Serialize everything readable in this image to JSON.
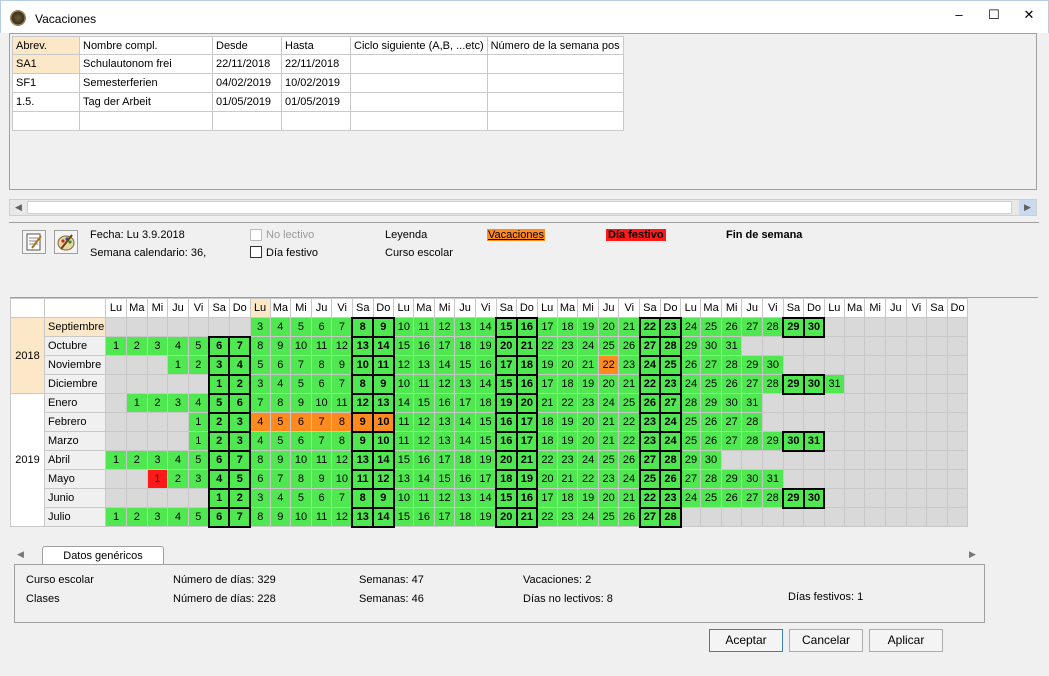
{
  "window": {
    "title": "Vacaciones",
    "minimize": "–",
    "maximize": "☐",
    "close": "✕",
    "icon": "app-clock-icon"
  },
  "holidays_table": {
    "columns": [
      "Abrev.",
      "Nombre compl.",
      "Desde",
      "Hasta",
      "Ciclo siguiente (A,B, ...etc)",
      "Número de la semana pos"
    ],
    "rows": [
      [
        "SA1",
        "Schulautonom frei",
        "22/11/2018",
        "22/11/2018",
        "",
        ""
      ],
      [
        "SF1",
        "Semesterferien",
        "04/02/2019",
        "10/02/2019",
        "",
        ""
      ],
      [
        "1.5.",
        "Tag der Arbeit",
        "01/05/2019",
        "01/05/2019",
        "",
        ""
      ],
      [
        "",
        "",
        "",
        "",
        "",
        ""
      ]
    ]
  },
  "info": {
    "fecha": "Fecha: Lu 3.9.2018",
    "semana": "Semana calendario: 36,",
    "no_lectivo": "No lectivo",
    "dia_festivo_chk": "Día festivo",
    "leyenda": "Leyenda",
    "curso_escolar": "Curso escolar",
    "legend_vacaciones": "Vacaciones",
    "legend_festivo": "Día festivo",
    "legend_fin_semana": "Fin de semana"
  },
  "colors": {
    "school_day": "#50e850",
    "vacation": "#ff8a1e",
    "holiday": "#ff1a1a",
    "outside": "#d9d9d9",
    "selected_header": "#fce8c8"
  },
  "calendar": {
    "weekday_headers": [
      "Lu",
      "Ma",
      "Mi",
      "Ju",
      "Vi",
      "Sa",
      "Do",
      "Lu",
      "Ma",
      "Mi",
      "Ju",
      "Vi",
      "Sa",
      "Do",
      "Lu",
      "Ma",
      "Mi",
      "Ju",
      "Vi",
      "Sa",
      "Do",
      "Lu",
      "Ma",
      "Mi",
      "Ju",
      "Vi",
      "Sa",
      "Do",
      "Lu",
      "Ma",
      "Mi",
      "Ju",
      "Vi",
      "Sa",
      "Do",
      "Lu",
      "Ma",
      "Mi",
      "Ju",
      "Vi",
      "Sa",
      "Do"
    ],
    "years": [
      {
        "year": "2018",
        "months": [
          "Septiembre",
          "Octubre",
          "Noviembre",
          "Diciembre"
        ]
      },
      {
        "year": "2019",
        "months": [
          "Enero",
          "Febrero",
          "Marzo",
          "Abril",
          "Mayo",
          "Junio",
          "Julio"
        ]
      }
    ],
    "rows": [
      [
        "x",
        "x",
        "x",
        "x",
        "x",
        "x",
        "x",
        "w:3",
        "w:4",
        "w:5",
        "w:6",
        "w:7",
        "b:8",
        "b:9",
        "w:10",
        "w:11",
        "w:12",
        "w:13",
        "w:14",
        "b:15",
        "b:16",
        "w:17",
        "w:18",
        "w:19",
        "w:20",
        "w:21",
        "b:22",
        "b:23",
        "w:24",
        "w:25",
        "w:26",
        "w:27",
        "w:28",
        "b:29",
        "b:30",
        "x",
        "x",
        "x",
        "x",
        "x",
        "x",
        "x"
      ],
      [
        "w:1",
        "w:2",
        "w:3",
        "w:4",
        "w:5",
        "b:6",
        "b:7",
        "w:8",
        "w:9",
        "w:10",
        "w:11",
        "w:12",
        "b:13",
        "b:14",
        "w:15",
        "w:16",
        "w:17",
        "w:18",
        "w:19",
        "b:20",
        "b:21",
        "w:22",
        "w:23",
        "w:24",
        "w:25",
        "w:26",
        "b:27",
        "b:28",
        "w:29",
        "w:30",
        "w:31",
        "x",
        "x",
        "x",
        "x",
        "x",
        "x",
        "x",
        "x",
        "x",
        "x",
        "x"
      ],
      [
        "x",
        "x",
        "x",
        "w:1",
        "w:2",
        "b:3",
        "b:4",
        "w:5",
        "w:6",
        "w:7",
        "w:8",
        "w:9",
        "b:10",
        "b:11",
        "w:12",
        "w:13",
        "w:14",
        "w:15",
        "w:16",
        "b:17",
        "b:18",
        "w:19",
        "w:20",
        "w:21",
        "h:22",
        "w:23",
        "b:24",
        "b:25",
        "w:26",
        "w:27",
        "w:28",
        "w:29",
        "w:30",
        "x",
        "x",
        "x",
        "x",
        "x",
        "x",
        "x",
        "x",
        "x"
      ],
      [
        "x",
        "x",
        "x",
        "x",
        "x",
        "b:1",
        "b:2",
        "w:3",
        "w:4",
        "w:5",
        "w:6",
        "w:7",
        "b:8",
        "b:9",
        "w:10",
        "w:11",
        "w:12",
        "w:13",
        "w:14",
        "b:15",
        "b:16",
        "w:17",
        "w:18",
        "w:19",
        "w:20",
        "w:21",
        "b:22",
        "b:23",
        "w:24",
        "w:25",
        "w:26",
        "w:27",
        "w:28",
        "b:29",
        "b:30",
        "w:31",
        "x",
        "x",
        "x",
        "x",
        "x",
        "x"
      ],
      [
        "x",
        "w:1",
        "w:2",
        "w:3",
        "w:4",
        "b:5",
        "b:6",
        "w:7",
        "w:8",
        "w:9",
        "w:10",
        "w:11",
        "b:12",
        "b:13",
        "w:14",
        "w:15",
        "w:16",
        "w:17",
        "w:18",
        "b:19",
        "b:20",
        "w:21",
        "w:22",
        "w:23",
        "w:24",
        "w:25",
        "b:26",
        "b:27",
        "w:28",
        "w:29",
        "w:30",
        "w:31",
        "x",
        "x",
        "x",
        "x",
        "x",
        "x",
        "x",
        "x",
        "x",
        "x"
      ],
      [
        "x",
        "x",
        "x",
        "x",
        "w:1",
        "b:2",
        "b:3",
        "h:4",
        "h:5",
        "h:6",
        "h:7",
        "h:8",
        "bh:9",
        "bh:10",
        "w:11",
        "w:12",
        "w:13",
        "w:14",
        "w:15",
        "b:16",
        "b:17",
        "w:18",
        "w:19",
        "w:20",
        "w:21",
        "w:22",
        "b:23",
        "b:24",
        "w:25",
        "w:26",
        "w:27",
        "w:28",
        "x",
        "x",
        "x",
        "x",
        "x",
        "x",
        "x",
        "x",
        "x",
        "x"
      ],
      [
        "x",
        "x",
        "x",
        "x",
        "w:1",
        "b:2",
        "b:3",
        "w:4",
        "w:5",
        "w:6",
        "w:7",
        "w:8",
        "b:9",
        "b:10",
        "w:11",
        "w:12",
        "w:13",
        "w:14",
        "w:15",
        "b:16",
        "b:17",
        "w:18",
        "w:19",
        "w:20",
        "w:21",
        "w:22",
        "b:23",
        "b:24",
        "w:25",
        "w:26",
        "w:27",
        "w:28",
        "w:29",
        "b:30",
        "b:31",
        "x",
        "x",
        "x",
        "x",
        "x",
        "x",
        "x"
      ],
      [
        "w:1",
        "w:2",
        "w:3",
        "w:4",
        "w:5",
        "b:6",
        "b:7",
        "w:8",
        "w:9",
        "w:10",
        "w:11",
        "w:12",
        "b:13",
        "b:14",
        "w:15",
        "w:16",
        "w:17",
        "w:18",
        "w:19",
        "b:20",
        "b:21",
        "w:22",
        "w:23",
        "w:24",
        "w:25",
        "w:26",
        "b:27",
        "b:28",
        "w:29",
        "w:30",
        "x",
        "x",
        "x",
        "x",
        "x",
        "x",
        "x",
        "x",
        "x",
        "x",
        "x",
        "x"
      ],
      [
        "x",
        "x",
        "f:1",
        "w:2",
        "w:3",
        "b:4",
        "b:5",
        "w:6",
        "w:7",
        "w:8",
        "w:9",
        "w:10",
        "b:11",
        "b:12",
        "w:13",
        "w:14",
        "w:15",
        "w:16",
        "w:17",
        "b:18",
        "b:19",
        "w:20",
        "w:21",
        "w:22",
        "w:23",
        "w:24",
        "b:25",
        "b:26",
        "w:27",
        "w:28",
        "w:29",
        "w:30",
        "w:31",
        "x",
        "x",
        "x",
        "x",
        "x",
        "x",
        "x",
        "x",
        "x"
      ],
      [
        "x",
        "x",
        "x",
        "x",
        "x",
        "b:1",
        "b:2",
        "w:3",
        "w:4",
        "w:5",
        "w:6",
        "w:7",
        "b:8",
        "b:9",
        "w:10",
        "w:11",
        "w:12",
        "w:13",
        "w:14",
        "b:15",
        "b:16",
        "w:17",
        "w:18",
        "w:19",
        "w:20",
        "w:21",
        "b:22",
        "b:23",
        "w:24",
        "w:25",
        "w:26",
        "w:27",
        "w:28",
        "b:29",
        "b:30",
        "x",
        "x",
        "x",
        "x",
        "x",
        "x",
        "x"
      ],
      [
        "w:1",
        "w:2",
        "w:3",
        "w:4",
        "w:5",
        "b:6",
        "b:7",
        "w:8",
        "w:9",
        "w:10",
        "w:11",
        "w:12",
        "b:13",
        "b:14",
        "w:15",
        "w:16",
        "w:17",
        "w:18",
        "w:19",
        "b:20",
        "b:21",
        "w:22",
        "w:23",
        "w:24",
        "w:25",
        "w:26",
        "b:27",
        "b:28",
        "x",
        "x",
        "x",
        "x",
        "x",
        "x",
        "x",
        "x",
        "x",
        "x",
        "x",
        "x",
        "x",
        "x"
      ]
    ]
  },
  "tabs": {
    "active": "Datos genéricos"
  },
  "generic": {
    "curso_label": "Curso escolar",
    "curso_dias": "Número de días: 329",
    "curso_semanas": "Semanas: 47",
    "curso_vacaciones": "Vacaciones: 2",
    "clases_label": "Clases",
    "clases_dias": "Número de días: 228",
    "clases_semanas": "Semanas: 46",
    "clases_no_lectivos": "Días no lectivos: 8",
    "dias_festivos": "Días festivos: 1"
  },
  "buttons": {
    "aceptar": "Aceptar",
    "cancelar": "Cancelar",
    "aplicar": "Aplicar"
  }
}
